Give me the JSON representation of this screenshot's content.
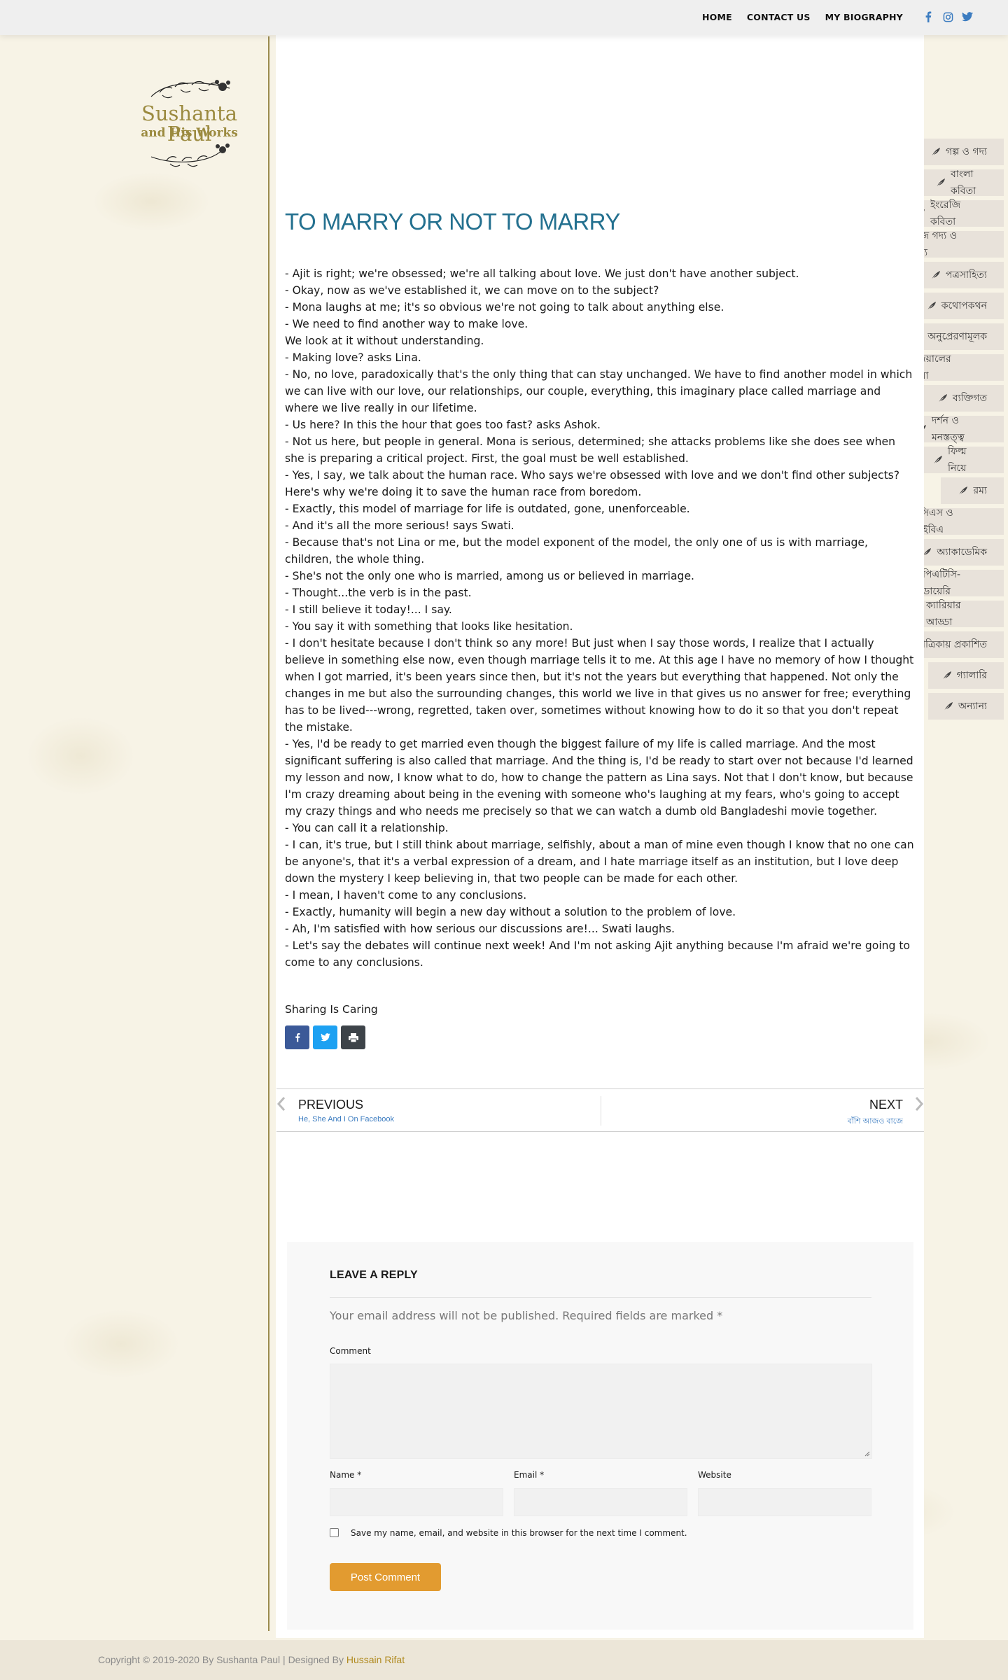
{
  "nav": {
    "home": "HOME",
    "contact": "CONTACT US",
    "bio": "MY BIOGRAPHY"
  },
  "social": [
    "facebook-icon",
    "instagram-icon",
    "twitter-icon"
  ],
  "logo": {
    "title": "Sushanta Paul",
    "subtitle": "and His Works"
  },
  "menu": [
    "গল্প ও গদ্য",
    "বাংলা কবিতা",
    "ইংরেজি কবিতা",
    "ইংরেজি গদ্য ও অন্যান্য",
    "পত্রসাহিত্য",
    "কথোপকথন",
    "অনুপ্রেরণামূলক",
    "ভাবনাদেয়ালের পলেস্তারা",
    "ব্যক্তিগত",
    "দর্শন ও মনস্তত্ত্ব",
    "ফিল্ম নিয়ে",
    "রম্য",
    "বিসিএস ও আইবিএ",
    "অ্যাকাডেমিক",
    "পিএটিসি-ডায়েরি",
    "ক্যারিয়ার আড্ডা",
    "পত্রিকায় প্রকাশিত",
    "গ্যালারি",
    "অন্যান্য"
  ],
  "post": {
    "title": "TO MARRY OR NOT TO MARRY",
    "lines": [
      "- Ajit is right; we're obsessed; we're all talking about love. We just don't have another subject.",
      "- Okay, now as we've established it, we can move on to the subject?",
      "- Mona laughs at me; it's so obvious we're not going to talk about anything else.",
      "- We need to find another way to make love.",
      "We look at it without understanding.",
      "- Making love? asks Lina.",
      "- No, no love, paradoxically that's the only thing that can stay unchanged. We have to find another model in which we can live with our love, our relationships, our couple, everything, this imaginary place called marriage and where we live really in our lifetime.",
      "- Us here? In this the hour that goes too fast? asks Ashok.",
      "- Not us here, but people in general. Mona is serious, determined; she attacks problems like she does see when she is preparing a critical project. First, the goal must be well established.",
      "- Yes, I say, we talk about the human race. Who says we're obsessed with love and we don't find other subjects? Here's why we're doing it to save the human race from boredom.",
      "- Exactly, this model of marriage for life is outdated, gone, unenforceable.",
      "- And it's all the more serious! says Swati.",
      "- Because that's not Lina or me, but the model exponent of the model, the only one of us is with marriage, children, the whole thing.",
      "- She's not the only one who is married, among us or believed in marriage.",
      "- Thought...the verb is in the past.",
      "- I still believe it today!... I say.",
      "- You say it with something that looks like hesitation.",
      "- I don't hesitate because I don't think so any more! But just when I say those words, I realize that I actually believe in something else now, even though marriage tells it to me. At this age I have no memory of how I thought when I got married, it's been years since then, but it's not the years but everything that happened. Not only the changes in me but also the surrounding changes, this world we live in that gives us no answer for free; everything has to be lived---wrong, regretted, taken over, sometimes without knowing how to do it so that you don't repeat the mistake.",
      "- Yes, I'd be ready to get married even though the biggest failure of my life is called marriage. And the most significant suffering is also called that marriage. And the thing is, I'd be ready to start over not because I'd learned my lesson and now, I know what to do, how to change the pattern as Lina says. Not that I don't know, but because I'm crazy dreaming about being in the evening with someone who's laughing at my fears, who's going to accept my crazy things and who needs me precisely so that we can watch a dumb old Bangladeshi movie together.",
      "- You can call it a relationship.",
      "- I can, it's true, but I still think about marriage, selfishly, about a man of mine even though I know that no one can be anyone's, that it's a verbal expression of a dream, and I hate marriage itself as an institution, but I love deep down the mystery I keep believing in, that two people can be made for each other.",
      "- I mean, I haven't come to any conclusions.",
      "- Exactly, humanity will begin a new day without a solution to the problem of love.",
      "- Ah, I'm satisfied with how serious our discussions are!... Swati laughs.",
      "- Let's say the debates will continue next week! And I'm not asking Ajit anything because I'm afraid we're going to come to any conclusions."
    ]
  },
  "share": {
    "label": "Sharing Is Caring",
    "buttons": [
      "facebook-icon",
      "twitter-icon",
      "print-icon"
    ],
    "colors": [
      "#3b5998",
      "#1da1f2",
      "#3d4349"
    ]
  },
  "postnav": {
    "prev_label": "PREVIOUS",
    "prev_title": "He, She And I On Facebook",
    "next_label": "NEXT",
    "next_title": "বাঁশি আজও বাজে"
  },
  "reply": {
    "heading": "LEAVE A REPLY",
    "notes": "Your email address will not be published. Required fields are marked *",
    "comment_label": "Comment",
    "name_label": "Name *",
    "email_label": "Email *",
    "website_label": "Website",
    "save_label": "Save my name, email, and website in this browser for the next time I comment.",
    "submit_label": "Post Comment"
  },
  "footer": {
    "text": "Copyright © 2019-2020 By Sushanta Paul | Designed By ",
    "designer": "Hussain Rifat"
  },
  "colors": {
    "title": "#23708f",
    "accent": "#e29b30",
    "logo": "#9b8a3f",
    "link": "#3c7cc0"
  }
}
